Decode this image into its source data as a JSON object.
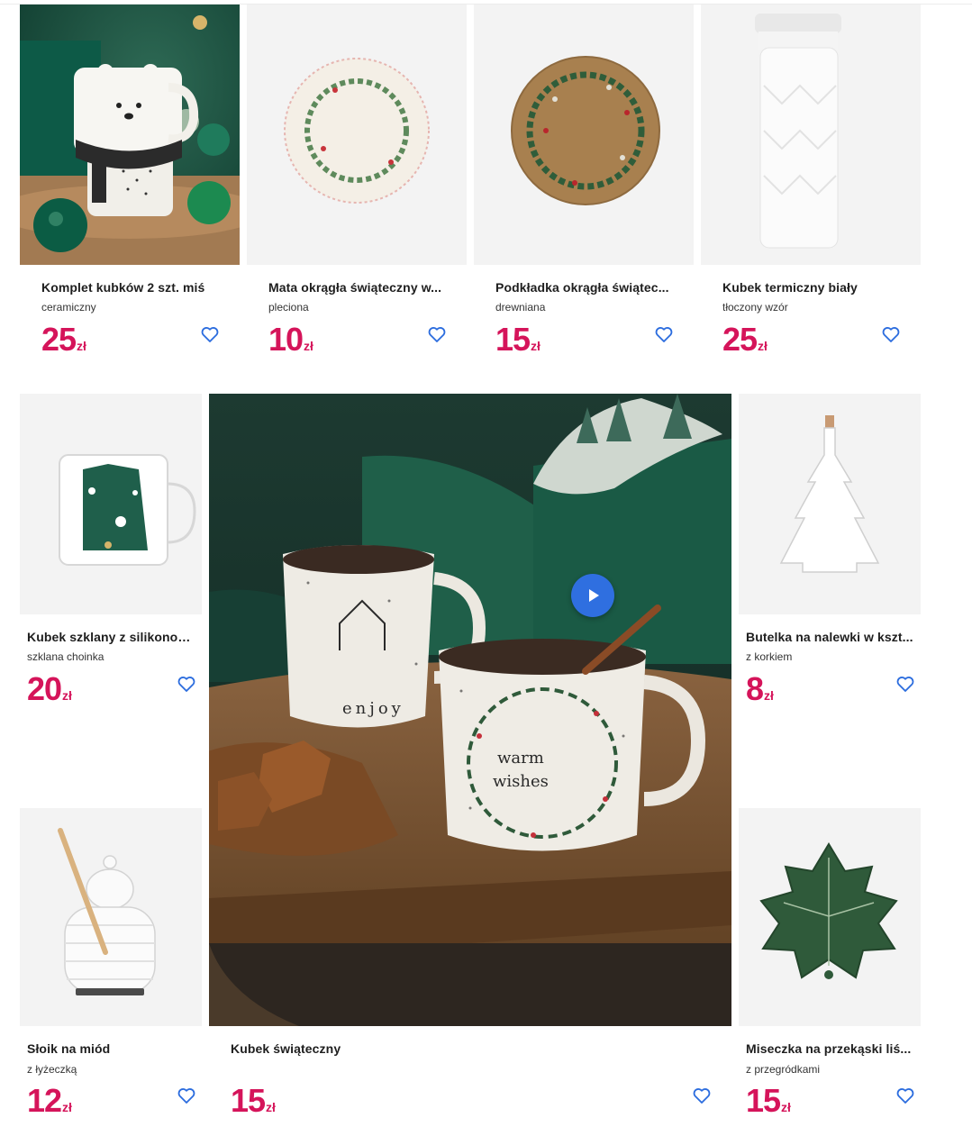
{
  "colors": {
    "price": "#d5145a",
    "heart": "#2b6cde",
    "play": "#2f6fe0"
  },
  "currency": "zł",
  "products": [
    {
      "title": "Komplet kubków 2 szt. miś",
      "subtitle": "ceramiczny",
      "price": "25",
      "image": "polar-bear-mugs-photo"
    },
    {
      "title": "Mata okrągła świąteczny w...",
      "subtitle": "pleciona",
      "price": "10",
      "image": "round-placemat-wreath"
    },
    {
      "title": "Podkładka okrągła świątec...",
      "subtitle": "drewniana",
      "price": "15",
      "image": "wooden-coaster-wreath"
    },
    {
      "title": "Kubek termiczny biały",
      "subtitle": "tłoczony wzór",
      "price": "25",
      "image": "white-thermal-mug"
    },
    {
      "title": "Kubek szklany z silikonow...",
      "subtitle": "szklana choinka",
      "price": "20",
      "image": "glass-tree-mug"
    },
    {
      "title": "Butelka na nalewki w kszt...",
      "subtitle": "z korkiem",
      "price": "8",
      "image": "tree-shaped-bottle"
    },
    {
      "title": "Słoik na miód",
      "subtitle": "z łyżeczką",
      "price": "12",
      "image": "honey-jar"
    },
    {
      "title": "Kubek świąteczny",
      "subtitle": "",
      "price": "15",
      "image": "christmas-mugs-video",
      "mug_text_1": "enjoy",
      "mug_text_2": "warm",
      "mug_text_3": "wishes"
    },
    {
      "title": "Miseczka na przekąski liś...",
      "subtitle": "z przegródkami",
      "price": "15",
      "image": "holly-leaf-bowl"
    }
  ]
}
